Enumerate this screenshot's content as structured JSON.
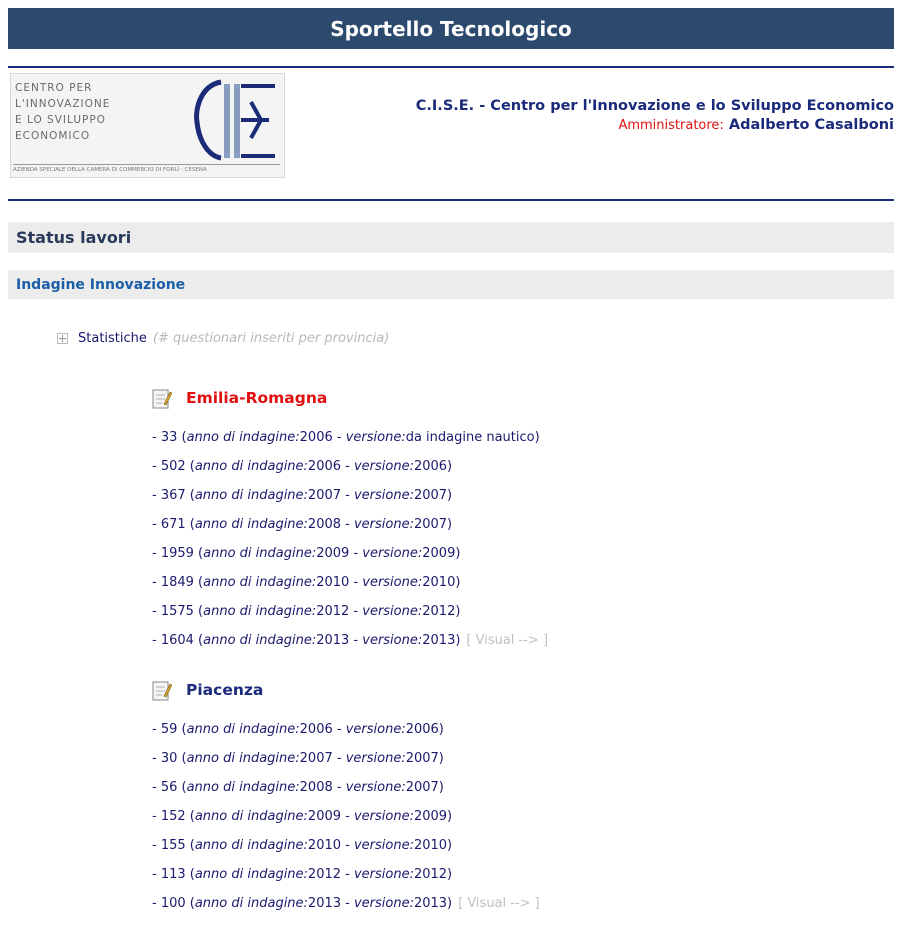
{
  "header": {
    "title": "Sportello Tecnologico",
    "org_name": "C.I.S.E. - Centro per l'Innovazione e lo Sviluppo Economico",
    "role_label": "Amministratore",
    "role_colon": ":",
    "admin_name": "Adalberto Casalboni"
  },
  "logo": {
    "line1": "CENTRO PER",
    "line2": "L'INNOVAZIONE",
    "line3": "E LO SVILUPPO",
    "line4": "ECONOMICO",
    "footer": "AZIENDA SPECIALE DELLA CAMERA DI COMMERCIO DI FORLÌ - CESENA"
  },
  "sections": {
    "status": "Status lavori",
    "indagine": "Indagine Innovazione"
  },
  "stats": {
    "label": "Statistiche",
    "hint": "(# questionari inseriti per provincia)"
  },
  "labels": {
    "anno": "anno di indagine:",
    "versione": "versione:",
    "visual": "[ Visual --> ]"
  },
  "regions": [
    {
      "name": "Emilia-Romagna",
      "rows": [
        {
          "count": "33",
          "anno": "2006",
          "versione": "da indagine nautico",
          "visual": false
        },
        {
          "count": "502",
          "anno": "2006",
          "versione": "2006",
          "visual": false
        },
        {
          "count": "367",
          "anno": "2007",
          "versione": "2007",
          "visual": false
        },
        {
          "count": "671",
          "anno": "2008",
          "versione": "2007",
          "visual": false
        },
        {
          "count": "1959",
          "anno": "2009",
          "versione": "2009",
          "visual": false
        },
        {
          "count": "1849",
          "anno": "2010",
          "versione": "2010",
          "visual": false
        },
        {
          "count": "1575",
          "anno": "2012",
          "versione": "2012",
          "visual": false
        },
        {
          "count": "1604",
          "anno": "2013",
          "versione": "2013",
          "visual": true
        }
      ]
    },
    {
      "name": "Piacenza",
      "rows": [
        {
          "count": "59",
          "anno": "2006",
          "versione": "2006",
          "visual": false
        },
        {
          "count": "30",
          "anno": "2007",
          "versione": "2007",
          "visual": false
        },
        {
          "count": "56",
          "anno": "2008",
          "versione": "2007",
          "visual": false
        },
        {
          "count": "152",
          "anno": "2009",
          "versione": "2009",
          "visual": false
        },
        {
          "count": "155",
          "anno": "2010",
          "versione": "2010",
          "visual": false
        },
        {
          "count": "113",
          "anno": "2012",
          "versione": "2012",
          "visual": false
        },
        {
          "count": "100",
          "anno": "2013",
          "versione": "2013",
          "visual": true
        }
      ]
    }
  ],
  "colors": {
    "title_bar": "#2b4a6d",
    "rule": "#1c2b78",
    "region_highlight": "#e01010",
    "link": "#1b5fa8",
    "text": "#1a1a6e"
  }
}
